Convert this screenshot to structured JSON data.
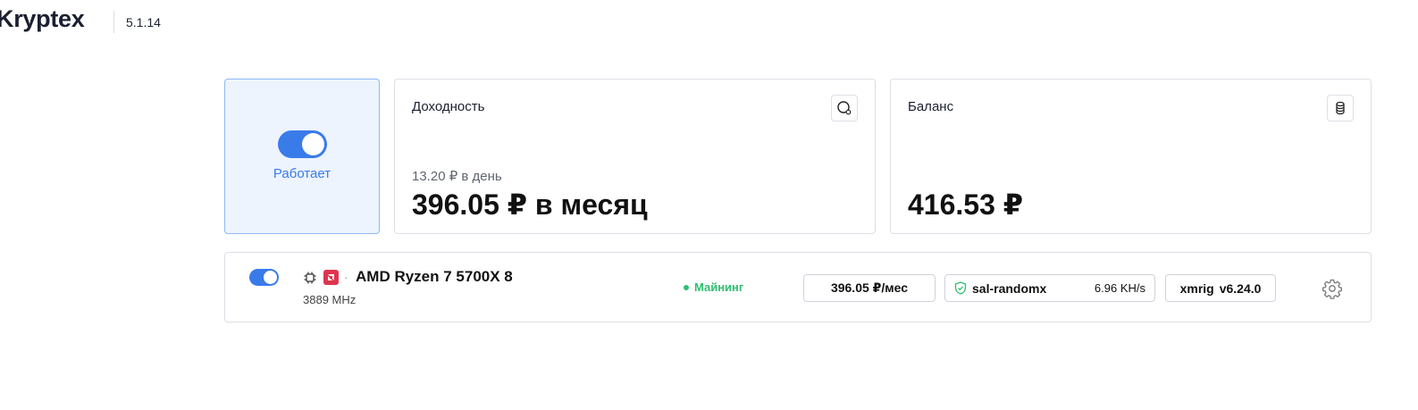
{
  "app": {
    "logo": "Kryptex",
    "version": "5.1.14"
  },
  "status_card": {
    "label": "Работает",
    "toggle_on": true
  },
  "income": {
    "title": "Доходность",
    "per_day": "13.20 ₽ в день",
    "per_month": "396.05 ₽ в месяц",
    "icon": "speedometer-icon"
  },
  "balance": {
    "title": "Баланс",
    "value": "416.53 ₽",
    "icon": "coins-stack-icon"
  },
  "device": {
    "enabled": true,
    "type_icon": "cpu-chip-icon",
    "vendor_icon": "amd-logo-icon",
    "separator": "·",
    "name": "AMD Ryzen 7 5700X 8",
    "frequency": "3889 MHz",
    "status": "Майнинг",
    "earnings": "396.05 ₽/мес",
    "algorithm": "sal-randomx",
    "algorithm_icon": "shield-check-icon",
    "hashrate": "6.96 KH/s",
    "miner_name": "xmrig",
    "miner_version": "v6.24.0",
    "settings_icon": "gear-icon"
  },
  "colors": {
    "accent": "#3a7bea",
    "status_bg": "#edf4fe",
    "mining_green": "#2fbf71",
    "amd_red": "#e0344e"
  }
}
